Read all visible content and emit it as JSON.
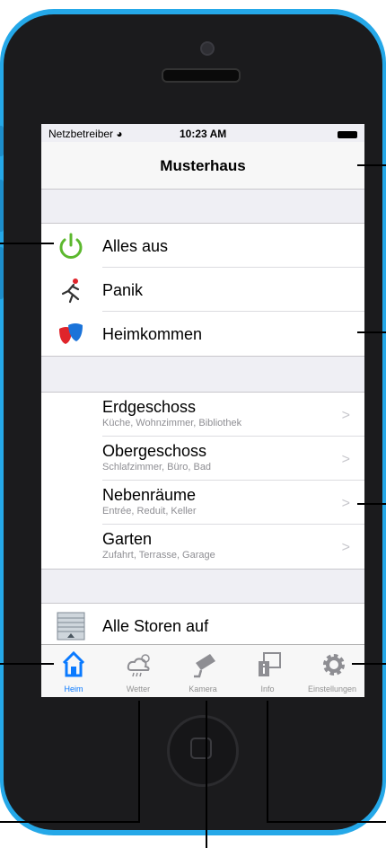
{
  "status_bar": {
    "carrier": "Netzbetreiber",
    "time": "10:23 AM"
  },
  "nav": {
    "title": "Musterhaus"
  },
  "actions": [
    {
      "label": "Alles aus",
      "icon": "power-icon"
    },
    {
      "label": "Panik",
      "icon": "running-man-icon"
    },
    {
      "label": "Heimkommen",
      "icon": "theater-masks-icon"
    }
  ],
  "rooms": [
    {
      "label": "Erdgeschoss",
      "sub": "Küche, Wohnzimmer, Bibliothek"
    },
    {
      "label": "Obergeschoss",
      "sub": "Schlafzimmer, Büro, Bad"
    },
    {
      "label": "Nebenräume",
      "sub": "Entrée, Reduit, Keller"
    },
    {
      "label": "Garten",
      "sub": "Zufahrt, Terrasse, Garage"
    }
  ],
  "blinds": {
    "label": "Alle Storen auf",
    "icon": "blinds-icon"
  },
  "tabs": [
    {
      "label": "Heim",
      "icon": "home-icon",
      "active": true
    },
    {
      "label": "Wetter",
      "icon": "weather-icon"
    },
    {
      "label": "Kamera",
      "icon": "camera-icon"
    },
    {
      "label": "Info",
      "icon": "info-icon"
    },
    {
      "label": "Einstellungen",
      "icon": "gear-icon"
    }
  ],
  "colors": {
    "device": "#25a8e8",
    "accent": "#0a7aff",
    "power": "#5cb82e"
  }
}
